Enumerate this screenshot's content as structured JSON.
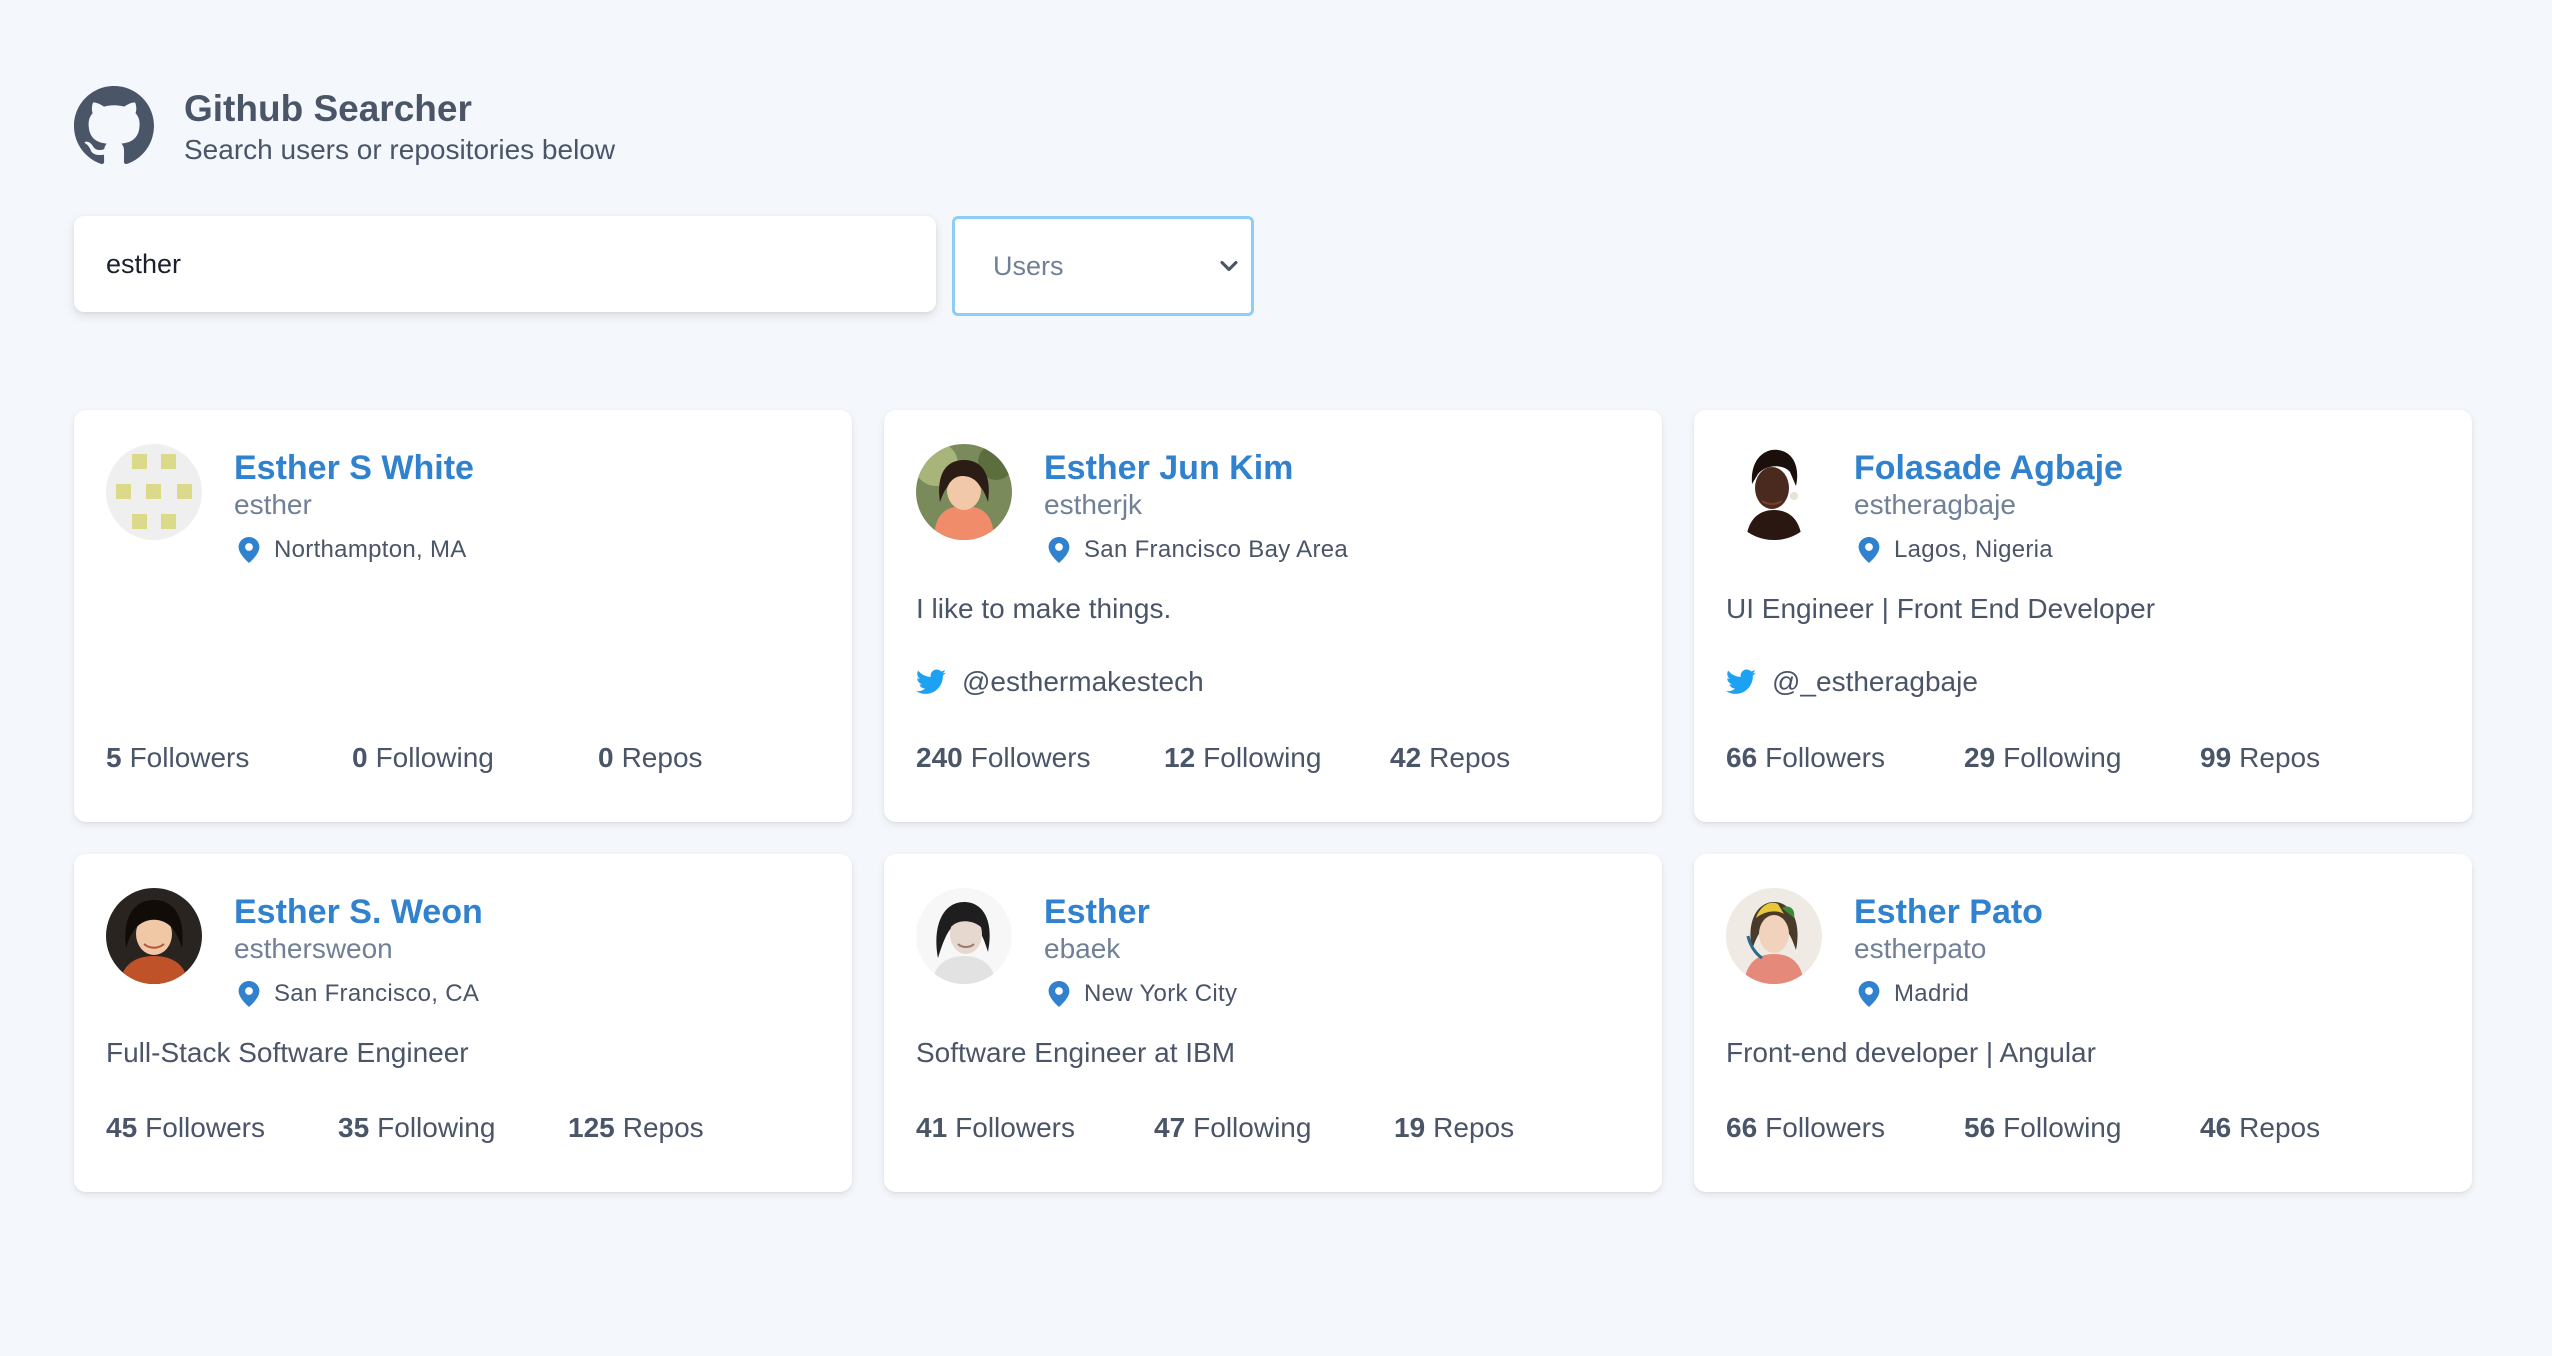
{
  "app": {
    "title": "Github Searcher",
    "subtitle": "Search users or repositories below",
    "logo_icon": "github-icon"
  },
  "search": {
    "value": "esther",
    "type_selected": "Users"
  },
  "colors": {
    "accent": "#3182ce",
    "text": "#4a5568",
    "muted": "#718096",
    "twitter": "#1da1f2",
    "background": "#f4f7fb"
  },
  "labels": {
    "followers": "Followers",
    "following": "Following",
    "repos": "Repos"
  },
  "users": [
    {
      "name": "Esther S White",
      "login": "esther",
      "location": "Northampton, MA",
      "bio": "",
      "twitter": "",
      "followers": "5",
      "following": "0",
      "repos": "0"
    },
    {
      "name": "Esther Jun Kim",
      "login": "estherjk",
      "location": "San Francisco Bay Area",
      "bio": "I like to make things.",
      "twitter": "@esthermakestech",
      "followers": "240",
      "following": "12",
      "repos": "42"
    },
    {
      "name": "Folasade Agbaje",
      "login": "estheragbaje",
      "location": "Lagos, Nigeria",
      "bio": "UI Engineer | Front End Developer",
      "twitter": "@_estheragbaje",
      "followers": "66",
      "following": "29",
      "repos": "99"
    },
    {
      "name": "Esther S. Weon",
      "login": "esthersweon",
      "location": "San Francisco, CA",
      "bio": "Full-Stack Software Engineer",
      "twitter": "",
      "followers": "45",
      "following": "35",
      "repos": "125"
    },
    {
      "name": "Esther",
      "login": "ebaek",
      "location": "New York City",
      "bio": "Software Engineer at IBM",
      "twitter": "",
      "followers": "41",
      "following": "47",
      "repos": "19"
    },
    {
      "name": "Esther Pato",
      "login": "estherpato",
      "location": "Madrid",
      "bio": "Front-end developer | Angular",
      "twitter": "",
      "followers": "66",
      "following": "56",
      "repos": "46"
    }
  ]
}
